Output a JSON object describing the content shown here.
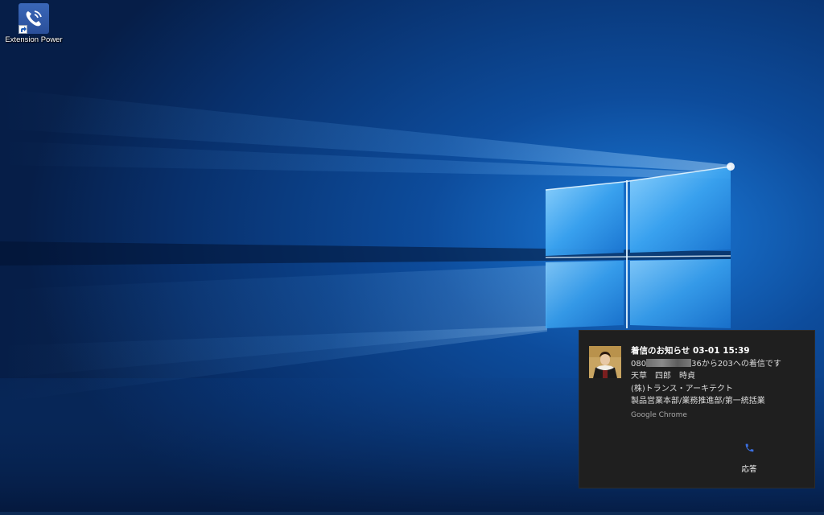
{
  "desktop": {
    "icons": [
      {
        "label": "Extension Power",
        "icon": "phone-ringing-icon"
      }
    ]
  },
  "notification": {
    "title": "着信のお知らせ",
    "time": "03-01 15:39",
    "caller_prefix": "080",
    "caller_suffix": "36から203への着信です",
    "lines": [
      "天草　四郎　時貞",
      "(株)トランス・アーキテクト",
      "製品営業本部/業務推進部/第一統括業"
    ],
    "source": "Google Chrome",
    "action": {
      "label": "応答",
      "icon": "phone-icon",
      "color": "#3b6fe0"
    }
  },
  "colors": {
    "toast_bg": "#1f1f1f",
    "wallpaper_base": "#0a2a5c",
    "accent": "#3b6fe0"
  }
}
